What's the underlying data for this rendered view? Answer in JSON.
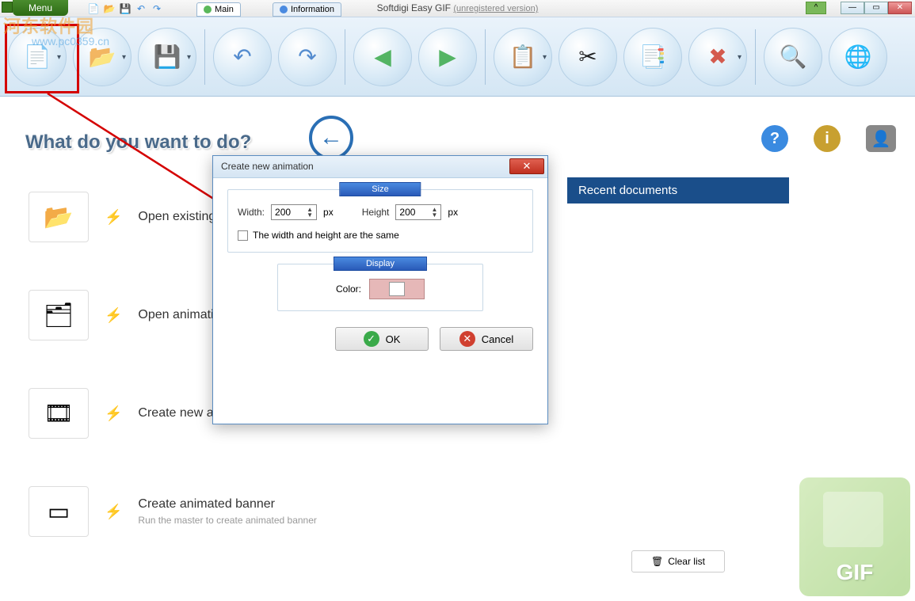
{
  "app": {
    "title": "Softdigi Easy GIF",
    "version_note": "(unregistered version)",
    "menu_label": "Menu"
  },
  "tabs": {
    "main": "Main",
    "info": "Information"
  },
  "heading": "What do you want to do?",
  "tasks": [
    {
      "title": "Open existing",
      "sub": ""
    },
    {
      "title": "Open animation",
      "sub": ""
    },
    {
      "title": "Create new an",
      "sub": ""
    },
    {
      "title": "Create animated banner",
      "sub": "Run the master to create animated banner"
    }
  ],
  "recent": {
    "header": "Recent documents",
    "clear": "Clear list"
  },
  "dialog": {
    "title": "Create new animation",
    "size_label": "Size",
    "width_label": "Width:",
    "width_value": "200",
    "height_label": "Height",
    "height_value": "200",
    "unit": "px",
    "same_label": "The width and height are the same",
    "display_label": "Display",
    "color_label": "Color:",
    "ok": "OK",
    "cancel": "Cancel"
  },
  "gif_mark": "GIF",
  "watermark": {
    "line1": "河东软件园",
    "line2": "www.pc0359.cn"
  }
}
